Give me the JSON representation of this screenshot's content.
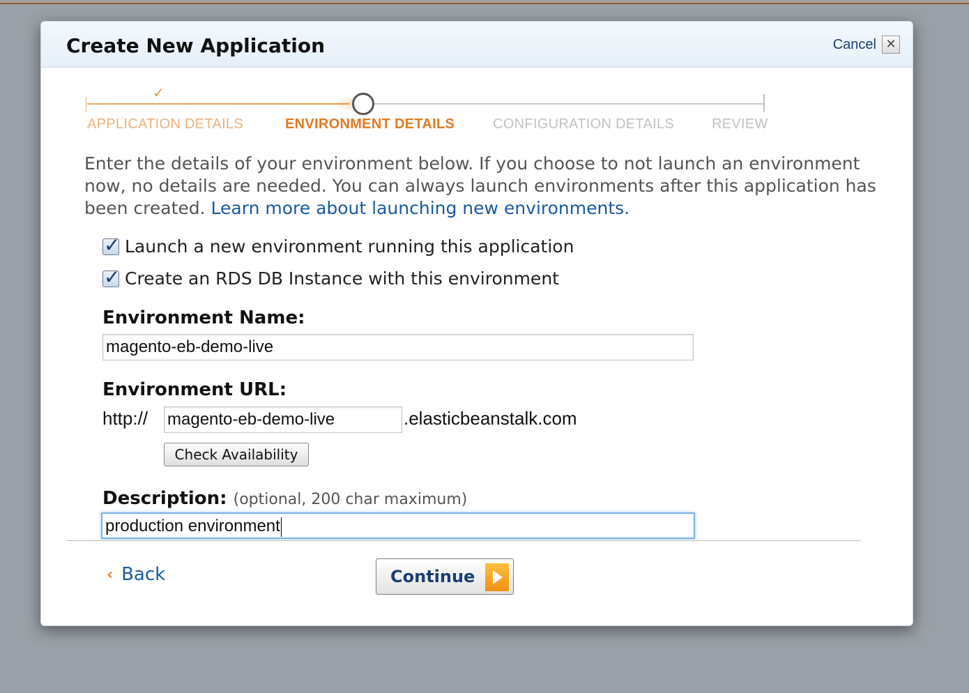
{
  "dialog": {
    "title": "Create New Application",
    "cancel_label": "Cancel",
    "close_glyph": "✕"
  },
  "steps": [
    {
      "label": "APPLICATION DETAILS",
      "state": "complete"
    },
    {
      "label": "ENVIRONMENT DETAILS",
      "state": "current"
    },
    {
      "label": "CONFIGURATION DETAILS",
      "state": "pending"
    },
    {
      "label": "REVIEW",
      "state": "pending"
    }
  ],
  "step_check_glyph": "✓",
  "intro": {
    "text": "Enter the details of your environment below. If you choose to not launch an environment now, no details are needed. You can always launch environments after this application has been created. ",
    "link_text": "Learn more about launching new environments."
  },
  "options": {
    "launch_env": {
      "label": "Launch a new environment running this application",
      "checked": true
    },
    "create_rds": {
      "label": "Create an RDS DB Instance with this environment",
      "checked": true
    }
  },
  "env_name": {
    "label": "Environment Name:",
    "value": "magento-eb-demo-live"
  },
  "env_url": {
    "label": "Environment URL:",
    "prefix": "http://",
    "value": "magento-eb-demo-live",
    "suffix": ".elasticbeanstalk.com",
    "check_button": "Check Availability"
  },
  "description": {
    "label": "Description:",
    "hint": "(optional, 200 char maximum)",
    "value": "production environment"
  },
  "footer": {
    "back_chevron": "‹",
    "back_label": "Back",
    "continue_label": "Continue"
  },
  "colors": {
    "accent_orange": "#e07b22",
    "link_blue": "#1a5aa0",
    "header_bg": "#e6eff8"
  }
}
